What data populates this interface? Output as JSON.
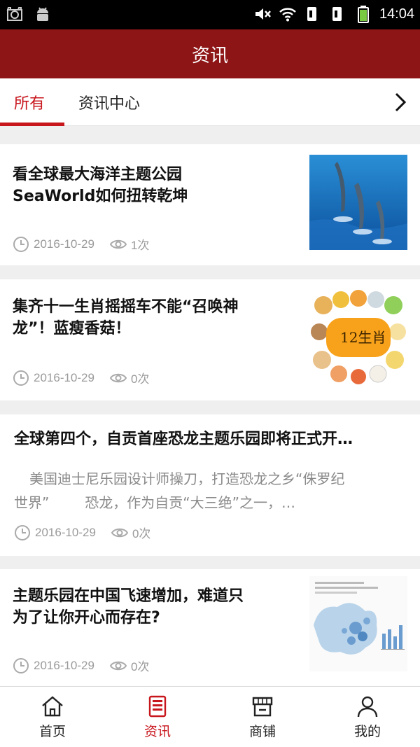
{
  "status_bar": {
    "time": "14:04"
  },
  "header": {
    "title": "资讯"
  },
  "tabs": [
    {
      "label": "所有",
      "active": true
    },
    {
      "label": "资讯中心",
      "active": false
    }
  ],
  "articles": [
    {
      "title_line1": "看全球最大海洋主题公园",
      "title_line2": "SeaWorld如何扭转乾坤",
      "date": "2016-10-29",
      "views": "1次",
      "thumb": "dolphins"
    },
    {
      "title_line1": "集齐十一生肖摇摇车不能“召唤神",
      "title_line2": "龙”！蓝瘦香菇！",
      "date": "2016-10-29",
      "views": "0次",
      "thumb": "zodiac",
      "thumb_text": "12生肖"
    },
    {
      "title": "全球第四个，自贡首座恐龙主题乐园即将正式开…",
      "excerpt_line1": "美国迪士尼乐园设计师操刀，打造恐龙之乡“侏罗纪",
      "excerpt_line2": "世界”        恐龙，作为自贡“大三绝”之一，…",
      "date": "2016-10-29",
      "views": "0次"
    },
    {
      "title_line1": "主题乐园在中国飞速增加，难道只",
      "title_line2": "为了让你开心而存在?",
      "date": "2016-10-29",
      "views": "0次",
      "thumb": "china-map"
    }
  ],
  "bottom_nav": [
    {
      "label": "首页",
      "icon": "home-icon",
      "active": false
    },
    {
      "label": "资讯",
      "icon": "news-icon",
      "active": true
    },
    {
      "label": "商铺",
      "icon": "shop-icon",
      "active": false
    },
    {
      "label": "我的",
      "icon": "user-icon",
      "active": false
    }
  ],
  "colors": {
    "brand": "#8e1516",
    "accent": "#c8161d"
  }
}
